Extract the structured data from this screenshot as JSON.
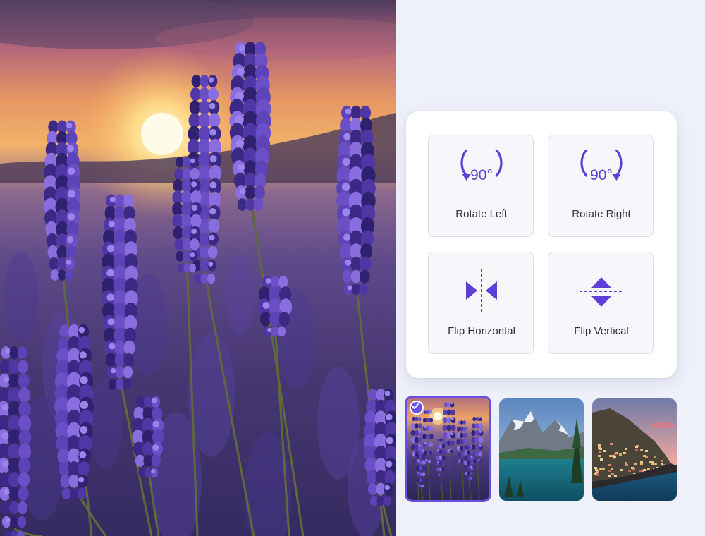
{
  "main_image": {
    "subject": "lavender field at sunset"
  },
  "transform_tools": {
    "rotate_left": {
      "label": "Rotate Left",
      "degrees": "90°",
      "icon": "rotate-left-icon"
    },
    "rotate_right": {
      "label": "Rotate Right",
      "degrees": "90°",
      "icon": "rotate-right-icon"
    },
    "flip_horizontal": {
      "label": "Flip Horizontal",
      "icon": "flip-horizontal-icon"
    },
    "flip_vertical": {
      "label": "Flip Vertical",
      "icon": "flip-vertical-icon"
    }
  },
  "thumbnails": [
    {
      "subject": "lavender sunset",
      "selected": true
    },
    {
      "subject": "mountain lake",
      "selected": false
    },
    {
      "subject": "coastal village",
      "selected": false
    }
  ],
  "colors": {
    "accent": "#6b4fe0",
    "panel_bg": "#eef0fa",
    "card_bg": "#ffffff",
    "button_bg": "#f7f7fb",
    "button_border": "#dcdce6",
    "label_text": "#2f2f3a"
  }
}
